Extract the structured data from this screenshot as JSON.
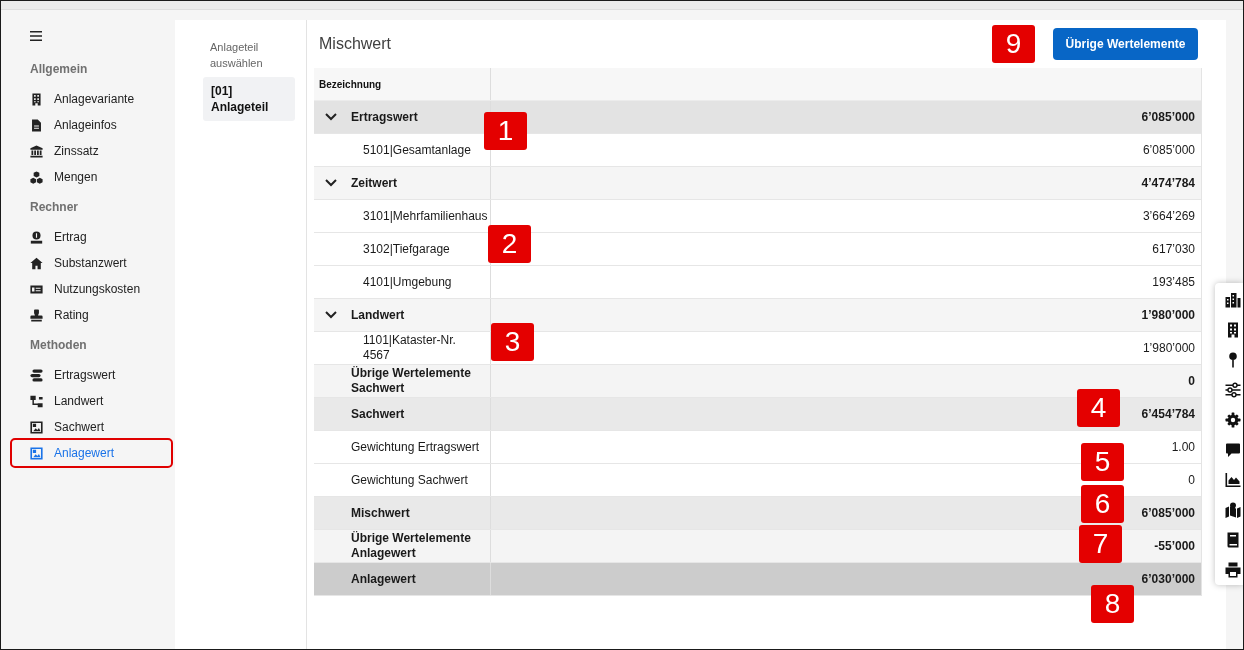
{
  "sidebar": {
    "sections": [
      {
        "title": "Allgemein",
        "items": [
          {
            "label": "Anlagevariante",
            "selected": false,
            "outlined": false
          },
          {
            "label": "Anlageinfos",
            "selected": false,
            "outlined": false
          },
          {
            "label": "Zinssatz",
            "selected": false,
            "outlined": false
          },
          {
            "label": "Mengen",
            "selected": false,
            "outlined": false
          }
        ]
      },
      {
        "title": "Rechner",
        "items": [
          {
            "label": "Ertrag",
            "selected": false,
            "outlined": false
          },
          {
            "label": "Substanzwert",
            "selected": false,
            "outlined": false
          },
          {
            "label": "Nutzungskosten",
            "selected": false,
            "outlined": false
          },
          {
            "label": "Rating",
            "selected": false,
            "outlined": false
          }
        ]
      },
      {
        "title": "Methoden",
        "items": [
          {
            "label": "Ertragswert",
            "selected": false,
            "outlined": false
          },
          {
            "label": "Landwert",
            "selected": false,
            "outlined": false
          },
          {
            "label": "Sachwert",
            "selected": false,
            "outlined": false
          },
          {
            "label": "Anlagewert",
            "selected": true,
            "outlined": true
          }
        ]
      }
    ]
  },
  "part_selector": {
    "title": "Anlageteil auswählen",
    "items": [
      {
        "label": "[01] Anlageteil",
        "selected": true
      }
    ]
  },
  "content": {
    "title": "Mischwert",
    "action_button": "Übrige Wertelemente"
  },
  "table": {
    "columns": [
      "Bezeichnung"
    ],
    "rows": [
      {
        "kind": "group",
        "label": "Ertragswert",
        "value": "6’085’000",
        "expanded": true,
        "highlighted": true,
        "children": [
          {
            "kind": "item",
            "label": "5101|Gesamtanlage",
            "value": "6’085’000"
          }
        ]
      },
      {
        "kind": "group",
        "label": "Zeitwert",
        "value": "4’474’784",
        "expanded": true,
        "highlighted": false,
        "children": [
          {
            "kind": "item",
            "label": "3101|Mehrfamilienhaus",
            "value": "3’664’269"
          },
          {
            "kind": "item",
            "label": "3102|Tiefgarage",
            "value": "617’030"
          },
          {
            "kind": "item",
            "label": "4101|Umgebung",
            "value": "193’485"
          }
        ]
      },
      {
        "kind": "group",
        "label": "Landwert",
        "value": "1’980’000",
        "expanded": true,
        "highlighted": false,
        "children": [
          {
            "kind": "item",
            "label": "1101|Kataster-Nr. 4567",
            "value": "1’980’000"
          }
        ]
      },
      {
        "kind": "other",
        "label": "Übrige Wertelemente Sachwert",
        "value": "0"
      },
      {
        "kind": "subtotal",
        "label": "Sachwert",
        "value": "6’454’784"
      },
      {
        "kind": "weight",
        "label": "Gewichtung Ertragswert",
        "value": "1.00"
      },
      {
        "kind": "weight",
        "label": "Gewichtung Sachwert",
        "value": "0"
      },
      {
        "kind": "subtotal",
        "label": "Mischwert",
        "value": "6’085’000"
      },
      {
        "kind": "other",
        "label": "Übrige Wertelemente Anlagewert",
        "value": "-55’000"
      },
      {
        "kind": "total",
        "label": "Anlagewert",
        "value": "6’030’000"
      }
    ]
  },
  "callouts": [
    {
      "label": "1"
    },
    {
      "label": "2"
    },
    {
      "label": "3"
    },
    {
      "label": "4"
    },
    {
      "label": "5"
    },
    {
      "label": "6"
    },
    {
      "label": "7"
    },
    {
      "label": "8"
    },
    {
      "label": "9"
    }
  ]
}
